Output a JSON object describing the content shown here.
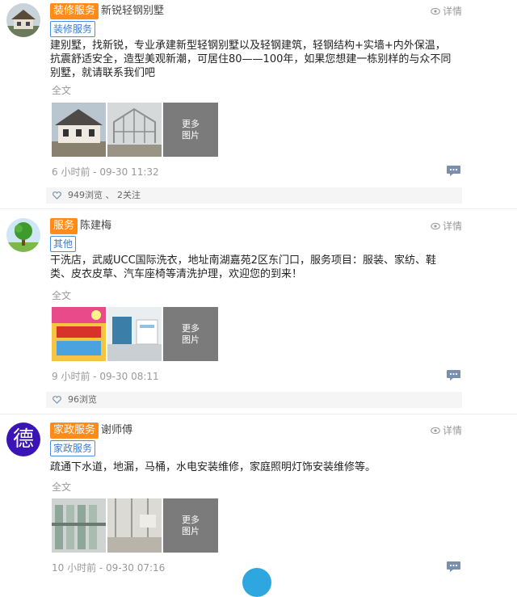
{
  "posts": [
    {
      "category": "装修服务",
      "author": "新锐轻钢别墅",
      "details_label": "详情",
      "subtag": "装修服务",
      "content": "建别墅，找新锐，专业承建新型轻钢别墅以及轻钢建筑，轻钢结构+实墙+内外保温，抗震舒适安全，造型美观新潮，可居住80——100年，如果您想建一栋别样的与众不同别墅，就请联系我们吧",
      "fulltext_label": "全文",
      "more_line1": "更多",
      "more_line2": "图片",
      "time": "6 小时前 - 09-30 11:32",
      "stats": "949浏览 、 2关注"
    },
    {
      "category": "服务",
      "author": "陈建梅",
      "details_label": "详情",
      "subtag": "其他",
      "content": "干洗店，武威UCC国际洗衣，地址南湖嘉苑2区东门口，服务项目：服装、家纺、鞋类、皮衣皮草、汽车座椅等清洗护理，欢迎您的到来！",
      "fulltext_label": "全文",
      "more_line1": "更多",
      "more_line2": "图片",
      "time": "9 小时前 - 09-30 08:11",
      "stats": "96浏览"
    },
    {
      "category": "家政服务",
      "author": "谢师傅",
      "avatar_char": "德",
      "details_label": "详情",
      "subtag": "家政服务",
      "content": "疏通下水道，地漏，马桶，水电安装维修，家庭照明灯饰安装维修等。",
      "fulltext_label": "全文",
      "more_line1": "更多",
      "more_line2": "图片",
      "time": "10 小时前 - 09-30 07:16"
    }
  ]
}
